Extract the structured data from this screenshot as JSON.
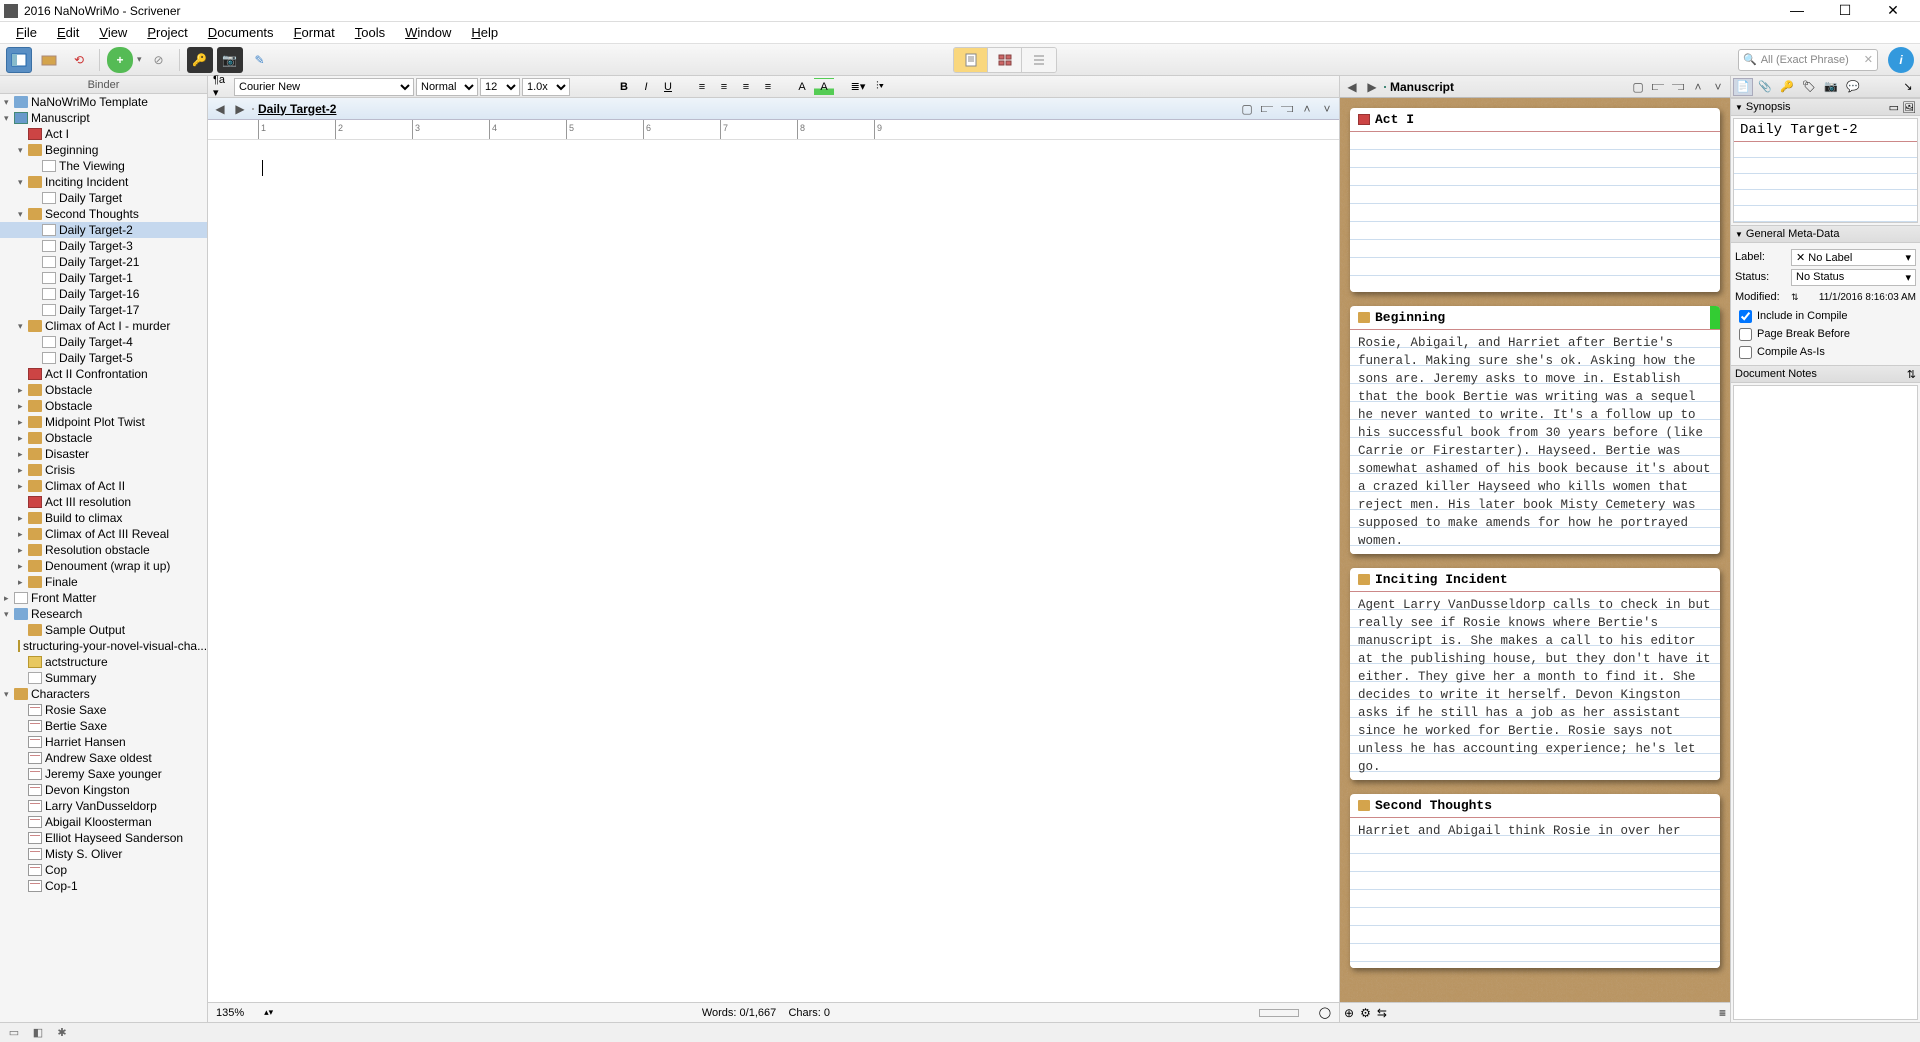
{
  "window": {
    "title": "2016 NaNoWriMo - Scrivener"
  },
  "menubar": [
    "File",
    "Edit",
    "View",
    "Project",
    "Documents",
    "Format",
    "Tools",
    "Window",
    "Help"
  ],
  "toolbar": {
    "search_placeholder": "All (Exact Phrase)"
  },
  "binder": {
    "header": "Binder",
    "tree": [
      {
        "depth": 0,
        "arrow": "▾",
        "icon": "folder-blue",
        "label": "NaNoWriMo Template"
      },
      {
        "depth": 0,
        "arrow": "▾",
        "icon": "doc-blue",
        "label": "Manuscript"
      },
      {
        "depth": 1,
        "arrow": "",
        "icon": "doc-red",
        "label": "Act I"
      },
      {
        "depth": 1,
        "arrow": "▾",
        "icon": "folder",
        "label": "Beginning"
      },
      {
        "depth": 2,
        "arrow": "",
        "icon": "doc",
        "label": "The Viewing"
      },
      {
        "depth": 1,
        "arrow": "▾",
        "icon": "folder",
        "label": "Inciting Incident"
      },
      {
        "depth": 2,
        "arrow": "",
        "icon": "doc",
        "label": "Daily Target"
      },
      {
        "depth": 1,
        "arrow": "▾",
        "icon": "folder",
        "label": "Second Thoughts"
      },
      {
        "depth": 2,
        "arrow": "",
        "icon": "doc",
        "label": "Daily Target-2",
        "selected": true
      },
      {
        "depth": 2,
        "arrow": "",
        "icon": "doc",
        "label": "Daily Target-3"
      },
      {
        "depth": 2,
        "arrow": "",
        "icon": "doc",
        "label": "Daily Target-21"
      },
      {
        "depth": 2,
        "arrow": "",
        "icon": "doc",
        "label": "Daily Target-1"
      },
      {
        "depth": 2,
        "arrow": "",
        "icon": "doc",
        "label": "Daily Target-16"
      },
      {
        "depth": 2,
        "arrow": "",
        "icon": "doc",
        "label": "Daily Target-17"
      },
      {
        "depth": 1,
        "arrow": "▾",
        "icon": "folder",
        "label": "Climax of Act I - murder"
      },
      {
        "depth": 2,
        "arrow": "",
        "icon": "doc",
        "label": "Daily Target-4"
      },
      {
        "depth": 2,
        "arrow": "",
        "icon": "doc",
        "label": "Daily Target-5"
      },
      {
        "depth": 1,
        "arrow": "",
        "icon": "doc-red",
        "label": "Act II Confrontation"
      },
      {
        "depth": 1,
        "arrow": "▸",
        "icon": "folder",
        "label": "Obstacle"
      },
      {
        "depth": 1,
        "arrow": "▸",
        "icon": "folder",
        "label": "Obstacle"
      },
      {
        "depth": 1,
        "arrow": "▸",
        "icon": "folder",
        "label": "Midpoint Plot Twist"
      },
      {
        "depth": 1,
        "arrow": "▸",
        "icon": "folder",
        "label": "Obstacle"
      },
      {
        "depth": 1,
        "arrow": "▸",
        "icon": "folder",
        "label": "Disaster"
      },
      {
        "depth": 1,
        "arrow": "▸",
        "icon": "folder",
        "label": "Crisis"
      },
      {
        "depth": 1,
        "arrow": "▸",
        "icon": "folder",
        "label": "Climax of Act II"
      },
      {
        "depth": 1,
        "arrow": "",
        "icon": "doc-red",
        "label": "Act III resolution"
      },
      {
        "depth": 1,
        "arrow": "▸",
        "icon": "folder",
        "label": "Build to climax"
      },
      {
        "depth": 1,
        "arrow": "▸",
        "icon": "folder",
        "label": "Climax of Act III Reveal"
      },
      {
        "depth": 1,
        "arrow": "▸",
        "icon": "folder",
        "label": "Resolution obstacle"
      },
      {
        "depth": 1,
        "arrow": "▸",
        "icon": "folder",
        "label": "Denoument (wrap it up)"
      },
      {
        "depth": 1,
        "arrow": "▸",
        "icon": "folder",
        "label": "Finale"
      },
      {
        "depth": 0,
        "arrow": "▸",
        "icon": "doc",
        "label": "Front Matter"
      },
      {
        "depth": 0,
        "arrow": "▾",
        "icon": "folder-blue",
        "label": "Research"
      },
      {
        "depth": 1,
        "arrow": "",
        "icon": "folder",
        "label": "Sample Output"
      },
      {
        "depth": 1,
        "arrow": "",
        "icon": "doc-yellow",
        "label": "structuring-your-novel-visual-cha..."
      },
      {
        "depth": 1,
        "arrow": "",
        "icon": "doc-yellow",
        "label": "actstructure"
      },
      {
        "depth": 1,
        "arrow": "",
        "icon": "doc",
        "label": "Summary"
      },
      {
        "depth": 0,
        "arrow": "▾",
        "icon": "folder",
        "label": "Characters"
      },
      {
        "depth": 1,
        "arrow": "",
        "icon": "card",
        "label": "Rosie Saxe"
      },
      {
        "depth": 1,
        "arrow": "",
        "icon": "card",
        "label": "Bertie Saxe"
      },
      {
        "depth": 1,
        "arrow": "",
        "icon": "card",
        "label": "Harriet Hansen"
      },
      {
        "depth": 1,
        "arrow": "",
        "icon": "card",
        "label": "Andrew Saxe oldest"
      },
      {
        "depth": 1,
        "arrow": "",
        "icon": "card",
        "label": "Jeremy Saxe younger"
      },
      {
        "depth": 1,
        "arrow": "",
        "icon": "card",
        "label": "Devon Kingston"
      },
      {
        "depth": 1,
        "arrow": "",
        "icon": "card",
        "label": "Larry VanDusseldorp"
      },
      {
        "depth": 1,
        "arrow": "",
        "icon": "card",
        "label": "Abigail Kloosterman"
      },
      {
        "depth": 1,
        "arrow": "",
        "icon": "card",
        "label": "Elliot Hayseed Sanderson"
      },
      {
        "depth": 1,
        "arrow": "",
        "icon": "card",
        "label": "Misty S. Oliver"
      },
      {
        "depth": 1,
        "arrow": "",
        "icon": "card",
        "label": "Cop"
      },
      {
        "depth": 1,
        "arrow": "",
        "icon": "card",
        "label": "Cop-1"
      }
    ]
  },
  "formatbar": {
    "font": "Courier New",
    "style": "Normal",
    "size": "12",
    "zoom": "1.0x"
  },
  "editor": {
    "doc_title": "Daily Target-2",
    "footer_zoom": "135%",
    "footer_words": "Words: 0/1,667",
    "footer_chars": "Chars: 0"
  },
  "corkboard": {
    "title": "Manuscript",
    "cards": [
      {
        "icon": "doc-red",
        "title": "Act I",
        "text": "",
        "label_color": ""
      },
      {
        "icon": "folder",
        "title": "Beginning",
        "text": "Rosie, Abigail, and Harriet after Bertie's funeral. Making sure she's ok. Asking how the sons are. Jeremy asks to move in. Establish that the book Bertie was writing was a sequel he never wanted to write. It's a follow up to his successful book from 30 years before (like Carrie or Firestarter). Hayseed. Bertie was somewhat ashamed of his book because it's about a crazed killer Hayseed who kills women that reject men. His later book Misty Cemetery was supposed to make amends for how he portrayed women.",
        "label_color": "#3c3"
      },
      {
        "icon": "folder",
        "title": "Inciting Incident",
        "text": "Agent Larry VanDusseldorp calls to check in but really see if Rosie knows where Bertie's manuscript is. She makes a call to his editor at the publishing house, but they don't have it either. They give her a month to find it. She decides to write it herself. Devon Kingston asks if he still has a job as her assistant since he worked for Bertie. Rosie says not unless he has accounting experience; he's let go.",
        "label_color": ""
      },
      {
        "icon": "folder",
        "title": "Second Thoughts",
        "text": "Harriet and Abigail think Rosie in over her",
        "label_color": ""
      }
    ]
  },
  "inspector": {
    "synopsis_header": "Synopsis",
    "synopsis_title": "Daily Target-2",
    "meta_header": "General Meta-Data",
    "label_label": "Label:",
    "label_value": "No Label",
    "status_label": "Status:",
    "status_value": "No Status",
    "modified_label": "Modified:",
    "modified_value": "11/1/2016 8:16:03 AM",
    "check_compile": "Include in Compile",
    "check_pagebreak": "Page Break Before",
    "check_asis": "Compile As-Is",
    "notes_header": "Document Notes"
  }
}
